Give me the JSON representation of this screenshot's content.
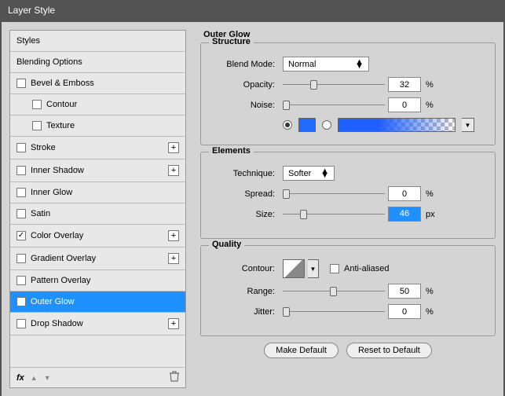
{
  "title": "Layer Style",
  "sidebar": {
    "items": [
      {
        "label": "Styles",
        "hasCheckbox": false,
        "indent": false,
        "hasPlus": false
      },
      {
        "label": "Blending Options",
        "hasCheckbox": false,
        "indent": false,
        "hasPlus": false
      },
      {
        "label": "Bevel & Emboss",
        "hasCheckbox": true,
        "checked": false,
        "indent": false,
        "hasPlus": false
      },
      {
        "label": "Contour",
        "hasCheckbox": true,
        "checked": false,
        "indent": true,
        "hasPlus": false
      },
      {
        "label": "Texture",
        "hasCheckbox": true,
        "checked": false,
        "indent": true,
        "hasPlus": false
      },
      {
        "label": "Stroke",
        "hasCheckbox": true,
        "checked": false,
        "indent": false,
        "hasPlus": true
      },
      {
        "label": "Inner Shadow",
        "hasCheckbox": true,
        "checked": false,
        "indent": false,
        "hasPlus": true
      },
      {
        "label": "Inner Glow",
        "hasCheckbox": true,
        "checked": false,
        "indent": false,
        "hasPlus": false
      },
      {
        "label": "Satin",
        "hasCheckbox": true,
        "checked": false,
        "indent": false,
        "hasPlus": false
      },
      {
        "label": "Color Overlay",
        "hasCheckbox": true,
        "checked": true,
        "indent": false,
        "hasPlus": true
      },
      {
        "label": "Gradient Overlay",
        "hasCheckbox": true,
        "checked": false,
        "indent": false,
        "hasPlus": true
      },
      {
        "label": "Pattern Overlay",
        "hasCheckbox": true,
        "checked": false,
        "indent": false,
        "hasPlus": false
      },
      {
        "label": "Outer Glow",
        "hasCheckbox": true,
        "checked": true,
        "indent": false,
        "hasPlus": false
      },
      {
        "label": "Drop Shadow",
        "hasCheckbox": true,
        "checked": false,
        "indent": false,
        "hasPlus": true
      }
    ],
    "selectedLabel": "Outer Glow",
    "fx": "fx"
  },
  "panel": {
    "heading": "Outer Glow",
    "structure": {
      "legend": "Structure",
      "blendModeLabel": "Blend Mode:",
      "blendModeValue": "Normal",
      "opacityLabel": "Opacity:",
      "opacityValue": "32",
      "opacityUnit": "%",
      "noiseLabel": "Noise:",
      "noiseValue": "0",
      "noiseUnit": "%",
      "colorSwatch": "#1f6bff"
    },
    "elements": {
      "legend": "Elements",
      "techniqueLabel": "Technique:",
      "techniqueValue": "Softer",
      "spreadLabel": "Spread:",
      "spreadValue": "0",
      "spreadUnit": "%",
      "sizeLabel": "Size:",
      "sizeValue": "46",
      "sizeUnit": "px"
    },
    "quality": {
      "legend": "Quality",
      "contourLabel": "Contour:",
      "antiAliasedLabel": "Anti-aliased",
      "rangeLabel": "Range:",
      "rangeValue": "50",
      "rangeUnit": "%",
      "jitterLabel": "Jitter:",
      "jitterValue": "0",
      "jitterUnit": "%"
    },
    "buttons": {
      "makeDefault": "Make Default",
      "resetDefault": "Reset to Default"
    }
  }
}
